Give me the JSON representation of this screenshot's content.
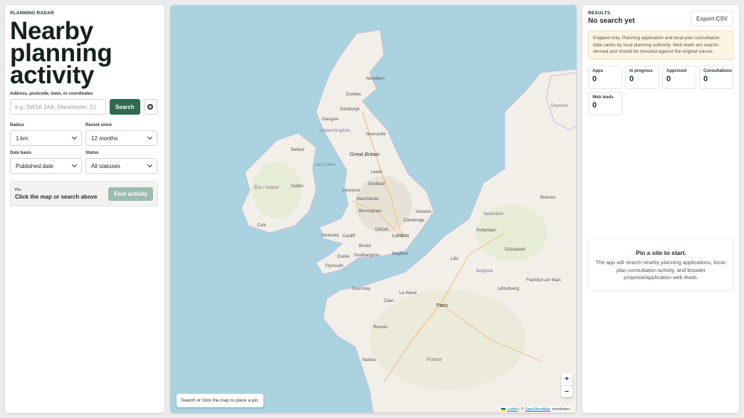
{
  "app": {
    "eyebrow": "PLANNING RADAR",
    "title_line1": "Nearby",
    "title_line2": "planning",
    "title_line3": "activity"
  },
  "search": {
    "label": "Address, postcode, town, or coordinates",
    "placeholder": "e.g. SW1A 1AA, Manchester, 51",
    "value": "",
    "button": "Search",
    "locate_icon": "locate-icon"
  },
  "filters": {
    "radius": {
      "label": "Radius",
      "value": "1 km"
    },
    "recent": {
      "label": "Recent since",
      "value": "12 months"
    },
    "date_basis": {
      "label": "Date basis",
      "value": "Published date"
    },
    "status": {
      "label": "Status",
      "value": "All statuses"
    }
  },
  "pin": {
    "label": "Pin",
    "value": "Click the map or search above",
    "button": "Find activity"
  },
  "map": {
    "hint": "Search or click the map to place a pin.",
    "zoom_in": "+",
    "zoom_out": "−",
    "attribution_leaflet": "Leaflet",
    "attribution_sep": "| ©",
    "attribution_osm": "OpenStreetMap",
    "attribution_rest": "contributors",
    "labels": {
      "united_kingdom": "United Kingdom",
      "great_britain": "Great Britain",
      "eire": "Éire / Ireland",
      "isle_of_man": "Isle of Man",
      "edinburgh": "Edinburgh",
      "glasgow": "Glasgow",
      "dundee": "Dundee",
      "aberdeen": "Aberdeen",
      "newcastle": "Newcastle",
      "belfast": "Belfast",
      "dublin": "Dublin",
      "cork": "Cork",
      "leeds": "Leeds",
      "sheffield": "Sheffield",
      "liverpool": "Liverpool",
      "manchester": "Manchester",
      "birmingham": "Birmingham",
      "norwich": "Norwich",
      "cambridge": "Cambridge",
      "oxford": "Oxford",
      "cardiff": "Cardiff",
      "swansea": "Swansea",
      "bristol": "Bristol",
      "london": "London",
      "brighton": "Brighton",
      "southampton": "Southampton",
      "plymouth": "Plymouth",
      "exeter": "Exeter",
      "lille": "Lille",
      "belgique": "Belgique",
      "paris": "Paris",
      "nederland": "Nederland",
      "rotterdam": "Rotterdam",
      "dusseldorf": "Düsseldorf",
      "bremen": "Bremen",
      "frankfurt": "Frankfurt am Main",
      "luxembourg": "Lëtzebuerg",
      "france": "France",
      "rennes": "Rennes",
      "le_havre": "Le Havre",
      "caen": "Caen",
      "nantes": "Nantes",
      "danmark": "Danmark",
      "guernsey": "Guernsey"
    }
  },
  "results": {
    "eyebrow": "RESULTS",
    "title": "No search yet",
    "export": "Export CSV",
    "notice": "England only. Planning application and local-plan consultation data varies by local planning authority. Web leads are search-derived and should be checked against the original source.",
    "stats": [
      {
        "label": "Apps",
        "value": "0"
      },
      {
        "label": "In progress",
        "value": "0"
      },
      {
        "label": "Approved",
        "value": "0"
      },
      {
        "label": "Consultations",
        "value": "0"
      },
      {
        "label": "Web leads",
        "value": "0"
      }
    ],
    "empty_title": "Pin a site to start.",
    "empty_body": "The app will search nearby planning applications, local-plan consultation activity, and broader proposal/application web leads."
  },
  "colors": {
    "accent": "#2f6b51",
    "accent_disabled": "#9dbcae",
    "water": "#aad3df",
    "land": "#f2efe9",
    "notice_bg": "#fdf4e2"
  }
}
